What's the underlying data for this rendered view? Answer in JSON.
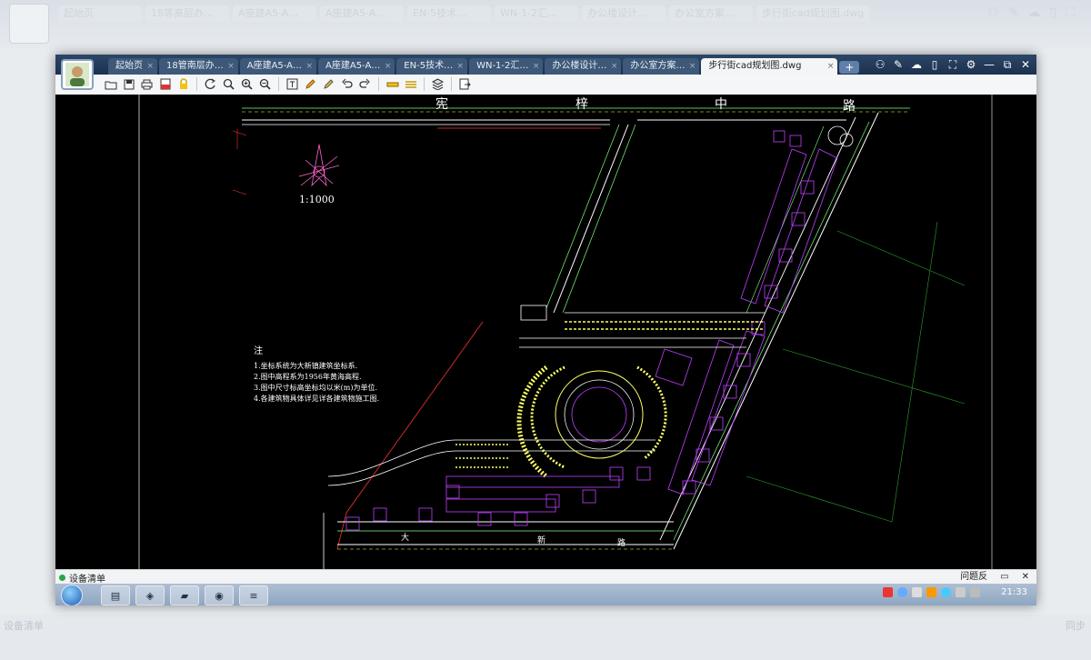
{
  "background": {
    "tabs": [
      "起始页",
      "18等高层办…",
      "A座建A5-A…",
      "A座建A5-A…",
      "EN-5技术…",
      "WN-1-2汇…",
      "办公楼设计…",
      "办公室方案…",
      "步行街cad规划图.dwg"
    ],
    "status_label": "设备清单",
    "status_right": "同步"
  },
  "window": {
    "tabs": [
      {
        "label": "起始页",
        "active": false
      },
      {
        "label": "18管南层办…",
        "active": false
      },
      {
        "label": "A座建A5-A…",
        "active": false
      },
      {
        "label": "A座建A5-A…",
        "active": false
      },
      {
        "label": "EN-5技术…",
        "active": false
      },
      {
        "label": "WN-1-2汇…",
        "active": false
      },
      {
        "label": "办公楼设计…",
        "active": false
      },
      {
        "label": "办公室方案…",
        "active": false
      },
      {
        "label": "步行街cad规划图.dwg",
        "active": true
      }
    ],
    "add_tab": "+",
    "tab_close": "×",
    "controls": [
      "—",
      "⧉",
      "✕"
    ]
  },
  "toolbar": {
    "icons": [
      "open-icon",
      "save-icon",
      "print-icon",
      "pdf-icon",
      "lock-icon",
      "rotate-icon",
      "zoom-window-icon",
      "zoom-in-icon",
      "zoom-out-icon",
      "text-icon",
      "pencil-icon",
      "marker-icon",
      "undo-icon",
      "redo-icon",
      "measure-icon",
      "dimension-icon",
      "layers-icon",
      "export-icon"
    ]
  },
  "drawing": {
    "road_top": [
      "宪",
      "梓",
      "中",
      "路"
    ],
    "road_bottom": [
      "大",
      "新",
      "路"
    ],
    "scale": "1:1000",
    "notes_title": "注",
    "notes": [
      "1.坐标系统为大新镇建筑坐标系.",
      "2.图中高程系为1956年黄海高程.",
      "3.图中尺寸标高坐标均以米(m)为单位.",
      "4.各建筑物具体详见详各建筑物施工图."
    ]
  },
  "statusbar": {
    "label": "设备清单",
    "feedback": "问题反",
    "close": "✕"
  },
  "taskbar": {
    "clock": "21:33"
  },
  "colors": {
    "cad_bg": "#000000",
    "road": "#ffffff",
    "building": "#c040ff",
    "greenery": "#3cff3c",
    "parcel": "#ffff66",
    "boundary": "#ff3030"
  }
}
